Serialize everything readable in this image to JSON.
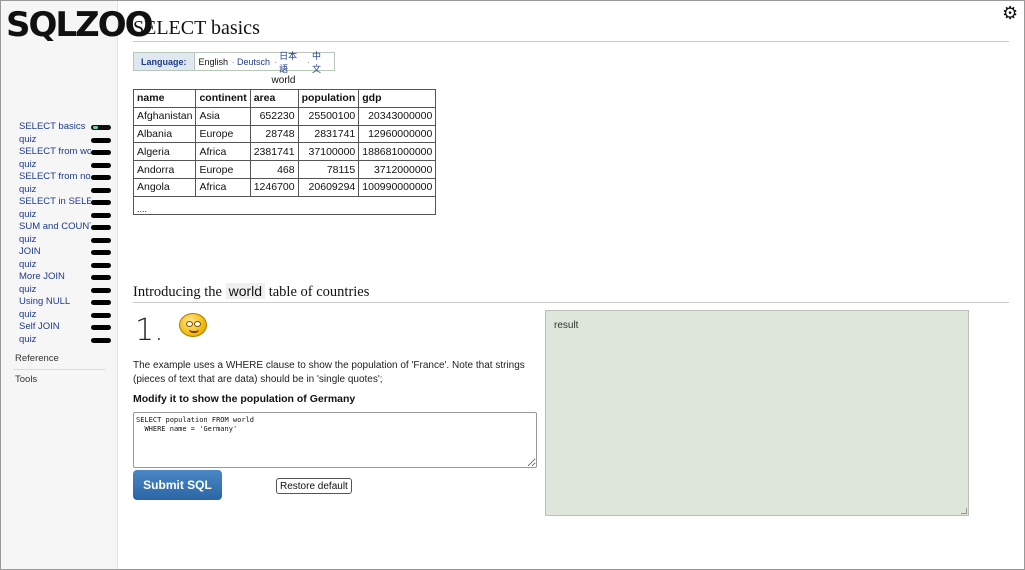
{
  "logo": {
    "text": "SQLZOO"
  },
  "sidebar": {
    "items": [
      {
        "label": "SELECT basics"
      },
      {
        "label": "quiz"
      },
      {
        "label": "SELECT from world"
      },
      {
        "label": "quiz"
      },
      {
        "label": "SELECT from nobel"
      },
      {
        "label": "quiz"
      },
      {
        "label": "SELECT in SELECT"
      },
      {
        "label": "quiz"
      },
      {
        "label": "SUM and COUNT"
      },
      {
        "label": "quiz"
      },
      {
        "label": "JOIN"
      },
      {
        "label": "quiz"
      },
      {
        "label": "More JOIN"
      },
      {
        "label": "quiz"
      },
      {
        "label": "Using NULL"
      },
      {
        "label": "quiz"
      },
      {
        "label": "Self JOIN"
      },
      {
        "label": "quiz"
      }
    ],
    "reference": "Reference",
    "tools": "Tools"
  },
  "header": {
    "title": "SELECT basics"
  },
  "language": {
    "label": "Language:",
    "options": [
      "English",
      "Deutsch",
      "日本語",
      "中文"
    ],
    "separator": "·"
  },
  "world_table": {
    "caption": "world",
    "columns": [
      "name",
      "continent",
      "area",
      "population",
      "gdp"
    ],
    "rows": [
      [
        "Afghanistan",
        "Asia",
        "652230",
        "25500100",
        "20343000000"
      ],
      [
        "Albania",
        "Europe",
        "28748",
        "2831741",
        "12960000000"
      ],
      [
        "Algeria",
        "Africa",
        "2381741",
        "37100000",
        "188681000000"
      ],
      [
        "Andorra",
        "Europe",
        "468",
        "78115",
        "3712000000"
      ],
      [
        "Angola",
        "Africa",
        "1246700",
        "20609294",
        "100990000000"
      ]
    ],
    "ellipsis": "...."
  },
  "section": {
    "heading_before": "Introducing the",
    "heading_code": "world",
    "heading_after": "table of countries"
  },
  "question": {
    "number": "1.",
    "description": "The example uses a WHERE clause to show the population of 'France'. Note that strings (pieces of text that are data) should be in 'single quotes';",
    "task": "Modify it to show the population of Germany",
    "sql": "SELECT population FROM world\n  WHERE name = 'Germany'",
    "submit_label": "Submit SQL",
    "restore_label": "Restore default"
  },
  "result": {
    "label": "result"
  },
  "colors": {
    "nav_link": "#1f3c88",
    "submit": "#2a66a6",
    "result_bg": "#dde6d9"
  }
}
